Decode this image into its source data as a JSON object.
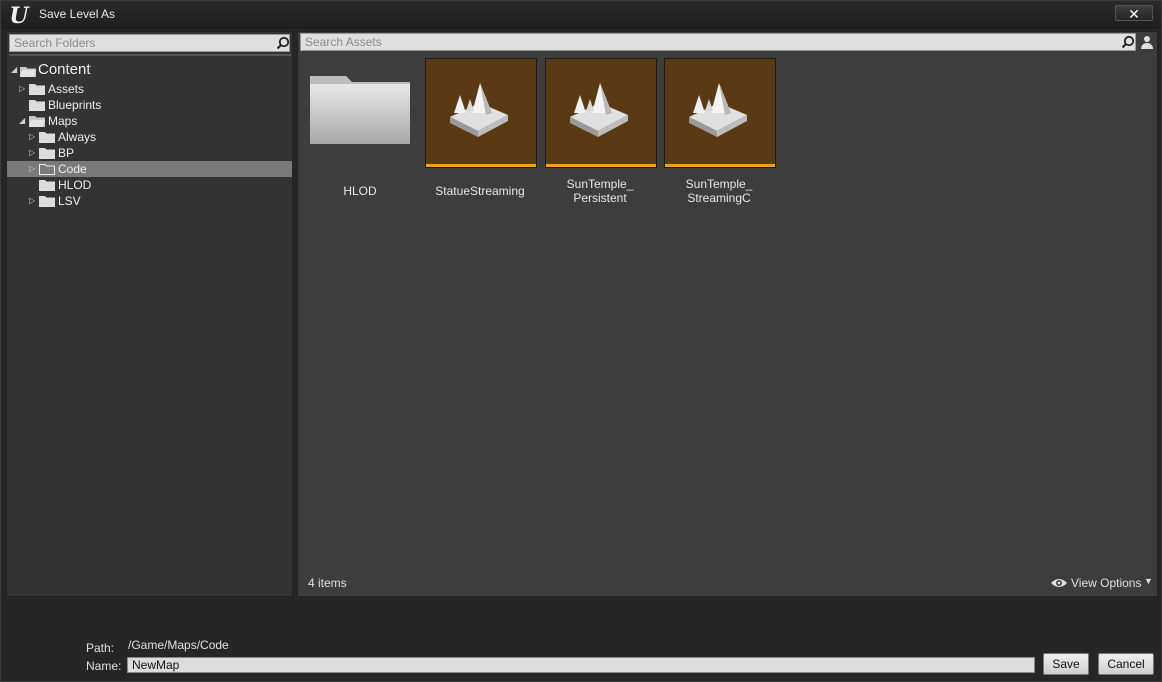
{
  "window": {
    "title": "Save Level As",
    "close_glyph": "✕"
  },
  "folders": {
    "search_placeholder": "Search Folders",
    "tree": [
      {
        "label": "Content",
        "depth": 0,
        "expanded": true
      },
      {
        "label": "Assets",
        "depth": 1,
        "expanded": false
      },
      {
        "label": "Blueprints",
        "depth": 1,
        "expanded": null
      },
      {
        "label": "Maps",
        "depth": 1,
        "expanded": true
      },
      {
        "label": "Always",
        "depth": 2,
        "expanded": false
      },
      {
        "label": "BP",
        "depth": 2,
        "expanded": false
      },
      {
        "label": "Code",
        "depth": 2,
        "expanded": false,
        "selected": true
      },
      {
        "label": "HLOD",
        "depth": 2,
        "expanded": null
      },
      {
        "label": "LSV",
        "depth": 2,
        "expanded": false
      }
    ]
  },
  "assets": {
    "search_placeholder": "Search Assets",
    "items": [
      {
        "label_line1": "HLOD",
        "label_line2": "",
        "type": "folder"
      },
      {
        "label_line1": "StatueStreaming",
        "label_line2": "",
        "type": "level"
      },
      {
        "label_line1": "SunTemple_",
        "label_line2": "Persistent",
        "type": "level"
      },
      {
        "label_line1": "SunTemple_",
        "label_line2": "StreamingC",
        "type": "level"
      }
    ],
    "count_text": "4 items",
    "view_options_label": "View Options"
  },
  "footer": {
    "path_label": "Path:",
    "path_value": "/Game/Maps/Code",
    "name_label": "Name:",
    "name_value": "NewMap",
    "save_label": "Save",
    "cancel_label": "Cancel"
  },
  "colors": {
    "level_tile_bg": "#5a3a12",
    "level_tile_strip": "#f0a020",
    "selection": "#7a7a7a"
  }
}
